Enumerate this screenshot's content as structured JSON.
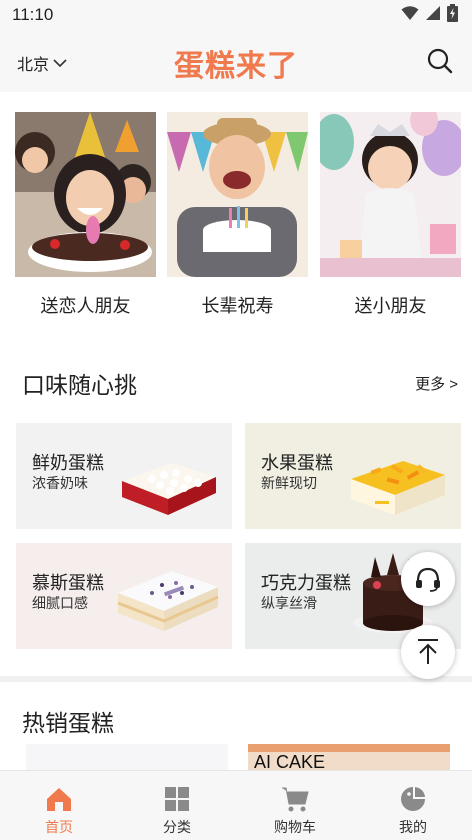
{
  "status": {
    "time": "11:10"
  },
  "header": {
    "city": "北京",
    "title": "蛋糕来了"
  },
  "scenes": [
    {
      "label": "送恋人朋友"
    },
    {
      "label": "长辈祝寿"
    },
    {
      "label": "送小朋友"
    }
  ],
  "flavor": {
    "title": "口味随心挑",
    "more": "更多 >",
    "cards": [
      {
        "name": "鲜奶蛋糕",
        "desc": "浓香奶味"
      },
      {
        "name": "水果蛋糕",
        "desc": "新鲜现切"
      },
      {
        "name": "慕斯蛋糕",
        "desc": "细腻口感"
      },
      {
        "name": "巧克力蛋糕",
        "desc": "纵享丝滑"
      }
    ]
  },
  "hot": {
    "title": "热销蛋糕",
    "banner_text": "AI CAKE"
  },
  "tabbar": {
    "items": [
      {
        "label": "首页"
      },
      {
        "label": "分类"
      },
      {
        "label": "购物车"
      },
      {
        "label": "我的"
      }
    ],
    "active_color": "#f07a4e"
  }
}
